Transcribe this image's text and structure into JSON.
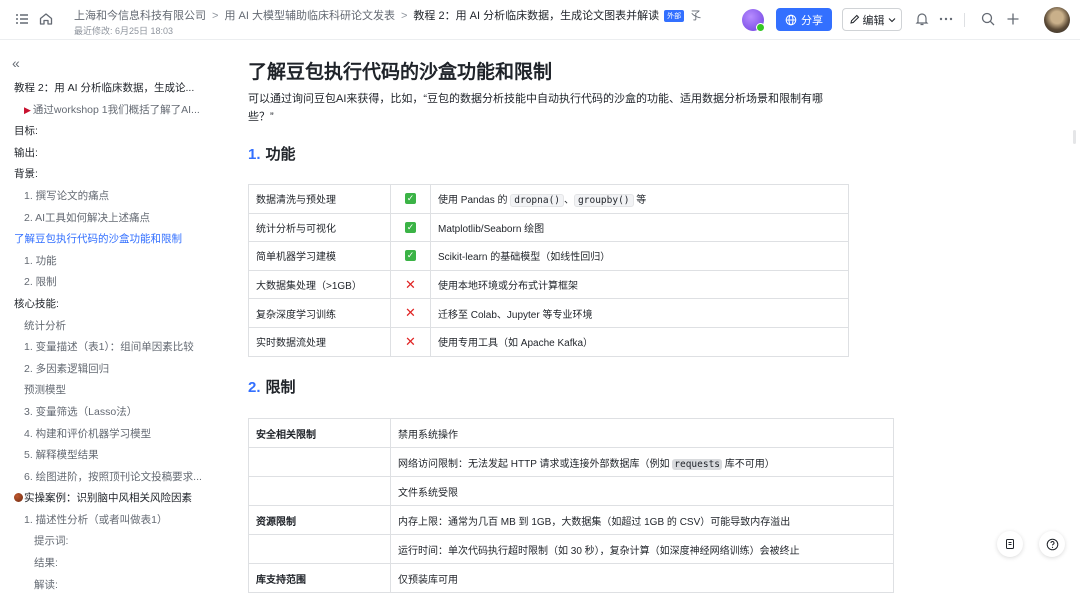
{
  "topbar": {
    "breadcrumb": [
      "上海和今信息科技有限公司",
      "用 AI 大模型辅助临床科研论文发表",
      "教程 2：用 AI 分析临床数据，生成论文图表并解读"
    ],
    "external_tag": "外部",
    "tail_glyph": "孓",
    "modified": "最近修改: 6月25日 18:03",
    "share_label": "分享",
    "edit_label": "编辑"
  },
  "sidebar": {
    "items": [
      {
        "label": "教程 2：用 AI 分析临床数据，生成论...",
        "level": 1
      },
      {
        "label": "通过workshop 1我们概括了解了AI...",
        "level": 2,
        "flag": true
      },
      {
        "label": "目标:",
        "level": 1
      },
      {
        "label": "输出:",
        "level": 1
      },
      {
        "label": "背景:",
        "level": 1
      },
      {
        "label": "1. 撰写论文的痛点",
        "level": 2
      },
      {
        "label": "2. AI工具如何解决上述痛点",
        "level": 2
      },
      {
        "label": "了解豆包执行代码的沙盒功能和限制",
        "level": 1,
        "active": true
      },
      {
        "label": "1. 功能",
        "level": 2
      },
      {
        "label": "2. 限制",
        "level": 2
      },
      {
        "label": "核心技能:",
        "level": 1
      },
      {
        "label": "统计分析",
        "level": 2
      },
      {
        "label": "1. 变量描述（表1）：组间单因素比较",
        "level": 2
      },
      {
        "label": "2. 多因素逻辑回归",
        "level": 2
      },
      {
        "label": "预测模型",
        "level": 2
      },
      {
        "label": "3. 变量筛选（Lasso法）",
        "level": 2
      },
      {
        "label": "4. 构建和评价机器学习模型",
        "level": 2
      },
      {
        "label": "5. 解释模型结果",
        "level": 2
      },
      {
        "label": "6. 绘图进阶，按照顶刊论文投稿要求...",
        "level": 2
      },
      {
        "label": "实操案例：识别脑中风相关风险因素",
        "level": 1,
        "ball": true
      },
      {
        "label": "1. 描述性分析（或者叫做表1）",
        "level": 2
      },
      {
        "label": "提示词:",
        "level": 3
      },
      {
        "label": "结果:",
        "level": 3
      },
      {
        "label": "解读:",
        "level": 3
      }
    ]
  },
  "main": {
    "title": "了解豆包执行代码的沙盒功能和限制",
    "intro": "可以通过询问豆包AI来获得，比如，“豆包的数据分析技能中自动执行代码的沙盒的功能、适用数据分析场景和限制有哪些？”",
    "sec1": {
      "num": "1.",
      "title": "功能"
    },
    "features": [
      {
        "name": "数据清洗与预处理",
        "ok": true,
        "pre": "使用 Pandas 的 ",
        "code1": "dropna()",
        "mid": "、",
        "code2": "groupby()",
        "post": " 等"
      },
      {
        "name": "统计分析与可视化",
        "ok": true,
        "desc": "Matplotlib/Seaborn 绘图"
      },
      {
        "name": "简单机器学习建模",
        "ok": true,
        "desc": "Scikit-learn 的基础模型（如线性回归）"
      },
      {
        "name": "大数据集处理（>1GB）",
        "ok": false,
        "desc": "使用本地环境或分布式计算框架"
      },
      {
        "name": "复杂深度学习训练",
        "ok": false,
        "desc": "迁移至 Colab、Jupyter 等专业环境"
      },
      {
        "name": "实时数据流处理",
        "ok": false,
        "desc": "使用专用工具（如 Apache Kafka）"
      }
    ],
    "sec2": {
      "num": "2.",
      "title": "限制"
    },
    "limits": [
      {
        "cat": "安全相关限制",
        "desc": "禁用系统操作"
      },
      {
        "cat": "",
        "pre": "网络访问限制：无法发起 HTTP 请求或连接外部数据库（例如 ",
        "code": "requests",
        "post": " 库不可用）"
      },
      {
        "cat": "",
        "desc": "文件系统受限"
      },
      {
        "cat": "资源限制",
        "desc": "内存上限：通常为几百 MB 到 1GB，大数据集（如超过 1GB 的 CSV）可能导致内存溢出"
      },
      {
        "cat": "",
        "desc": "运行时间：单次代码执行超时限制（如 30 秒），复杂计算（如深度神经网络训练）会被终止"
      },
      {
        "cat": "库支持范围",
        "desc": "仅预装库可用"
      }
    ]
  }
}
